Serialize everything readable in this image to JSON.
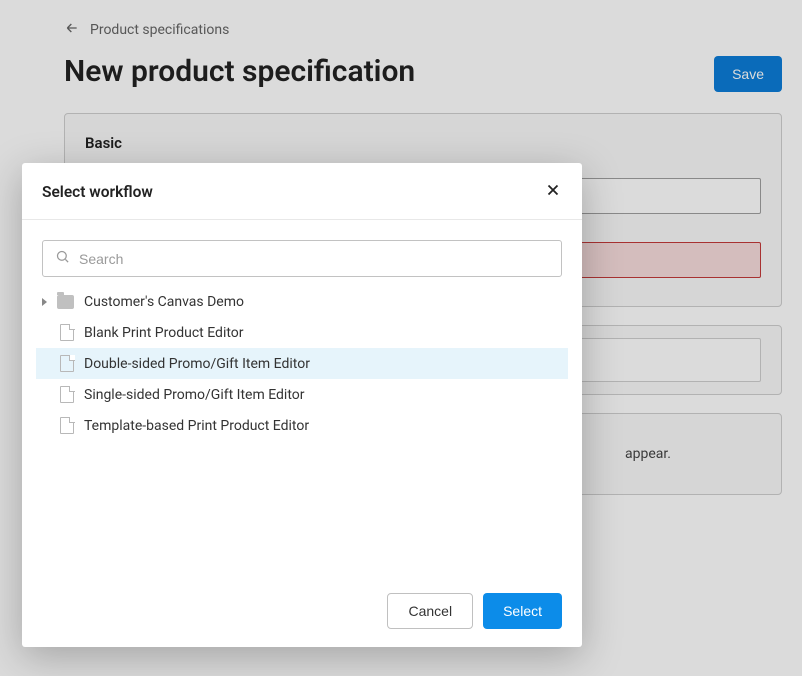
{
  "breadcrumb": {
    "label": "Product specifications"
  },
  "page": {
    "title": "New product specification",
    "save_label": "Save"
  },
  "panel_basic": {
    "title": "Basic"
  },
  "panel_text": {
    "fragment": "appear."
  },
  "modal": {
    "title": "Select workflow",
    "search_placeholder": "Search",
    "cancel_label": "Cancel",
    "select_label": "Select",
    "folder_label": "Customer's Canvas Demo",
    "items": [
      {
        "label": "Blank Print Product Editor"
      },
      {
        "label": "Double-sided Promo/Gift Item Editor"
      },
      {
        "label": "Single-sided Promo/Gift Item Editor"
      },
      {
        "label": "Template-based Print Product Editor"
      }
    ]
  }
}
